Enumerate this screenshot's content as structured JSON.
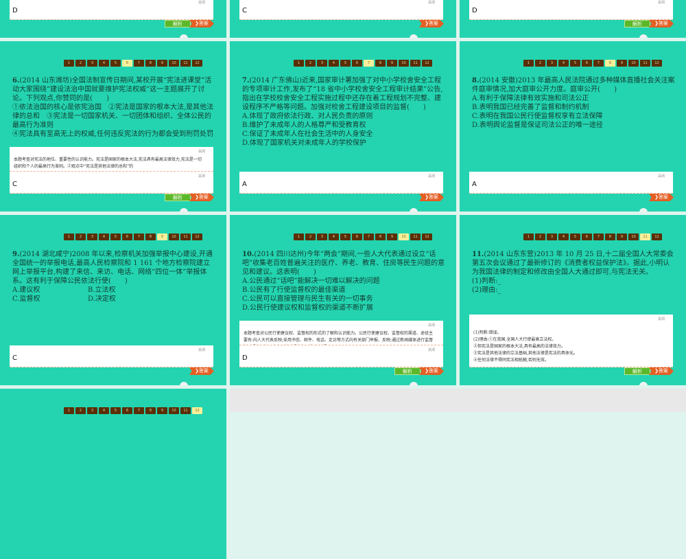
{
  "close_label": "关闭",
  "analysis_label": "解析",
  "answer_label": "❯答案",
  "nav_pages": [
    "1",
    "2",
    "3",
    "4",
    "5",
    "6",
    "7",
    "8",
    "9",
    "10",
    "11",
    "12"
  ],
  "top_row": [
    {
      "answer": "D",
      "has_analysis": true
    },
    {
      "answer": "C",
      "has_analysis": false
    },
    {
      "answer": "D",
      "has_analysis": true
    }
  ],
  "slides": [
    {
      "current": 5,
      "number": "6.",
      "lines": [
        "(2014 山东潍坊)全国法制宣传日期间,某校开展“宪法进课堂”活动大家围绕“建设法治中国就要维护宪法权威”这一主题展开了讨论。下列观点,你赞同的是(　　)",
        "①依法治国的核心是依宪治国　②宪法是国家的根本大法,是其他法律的总和　③宪法是一切国家机关、一切团体和组织、全体公民的最高行为准则",
        "④宪法具有至高无上的权威,任何违反宪法的行为都会受到刑罚处罚"
      ],
      "explanation": "本题考查对宪法的地位、重要性的认识能力。宪法是国家的根本大法,宪法具有最高法律效力,宪法是一切组织和个人的最高行为准则。②观点中“宪法是其他法律的总和”的",
      "answer": "C"
    },
    {
      "current": 6,
      "number": "7.",
      "lines": [
        "(2014 广东佛山)近来,国家审计署加强了对中小学校舍安全工程的专项审计工作,发布了“18 省中小学校舍安全工程审计结果”公告,指出在学校校舍安全工程实施过程中还存在着工程规划不完整、建设程序不严格等问题。加强对校舍工程建设项目的监督(　　)",
        "A.体现了政府依法行政、对人民负责的原则",
        "B.维护了未成年人的人格尊严和受教育权",
        "C.保证了未成年人在社会生活中的人身安全",
        "D.体现了国家机关对未成年人的学校保护"
      ],
      "answer": "A"
    },
    {
      "current": 7,
      "number": "8.",
      "lines": [
        "(2014 安徽)2013 年最高人民法院通过多种媒体直播社会关注案件庭审情况,加大庭审公开力度。庭审公开(　　)",
        "A.有利于保障法律有效实施和司法公正",
        "B.表明我国已经完善了监督和制约机制",
        "C.表明在我国公民行使监督权享有立法保障",
        "D.表明舆论监督是保证司法公正的唯一途径"
      ],
      "answer": "A"
    },
    {
      "current": 8,
      "number": "9.",
      "lines": [
        "(2014 湖北咸宁)2008 年以来,检察机关加强举报中心建设,开通全国统一的举报电话,最高人民检察院和 1 161 个地方检察院建立网上举报平台,构建了来信、来访、电话、网络“四位一体”举报体系。这有利于保障公民依法行使(　　)"
      ],
      "opts": [
        [
          "A.建议权",
          "B.立法权"
        ],
        [
          "C.监督权",
          "D.决定权"
        ]
      ],
      "answer": "C"
    },
    {
      "current": 9,
      "number": "10.",
      "lines": [
        "(2014 四川达州)今年“两会”期间,一些人大代表通过设立“话吧”收集老百姓普遍关注的医疗、养老、教育、住房等民生问题的意见和建议。这表明(　　)",
        "A.公民通过“话吧”能解决一切难以解决的问题",
        "B.公民有了行使监督权的最佳渠道",
        "C.公民可以直接管理与民生有关的一切事务",
        "D.公民行使建议权和监督权的渠道不断扩展"
      ],
      "explanation": "本题考查对公民行使建议权、监督权的形式的了解和认识能力。公民行使建议权、监督权的渠道、途径主要有:向人大代表反映;采用书信、邮件、电话、走访等方式向有关部门举报、反映;通过新闻媒体进行监督等。通过“话吧”向人大代表提出意见和建议,是公",
      "answer": "D"
    },
    {
      "current": 10,
      "number": "11.",
      "lines": [
        "(2014 山东东营)2013 年 10 月 25 日,十二届全国人大常委会第五次会议通过了最新修订的《消费者权益保护法》。据此,小明认为我国法律的制定和修改由全国人大通过即可,与宪法无关。",
        "(1)判断:_",
        "(2)理由:_"
      ],
      "tall_explanation": [
        "(1)判断:错误。",
        "(2)理由:①在我国,全国人大行使最高立法权。",
        "②但宪法是国家的根本大法,具有最高的法律效力。",
        "③宪法是其他法律的立法基础,其他法律是宪法的具体化。",
        "④任何法律不得同宪法相抵触,否则无效。"
      ]
    },
    {
      "current": 11
    }
  ]
}
